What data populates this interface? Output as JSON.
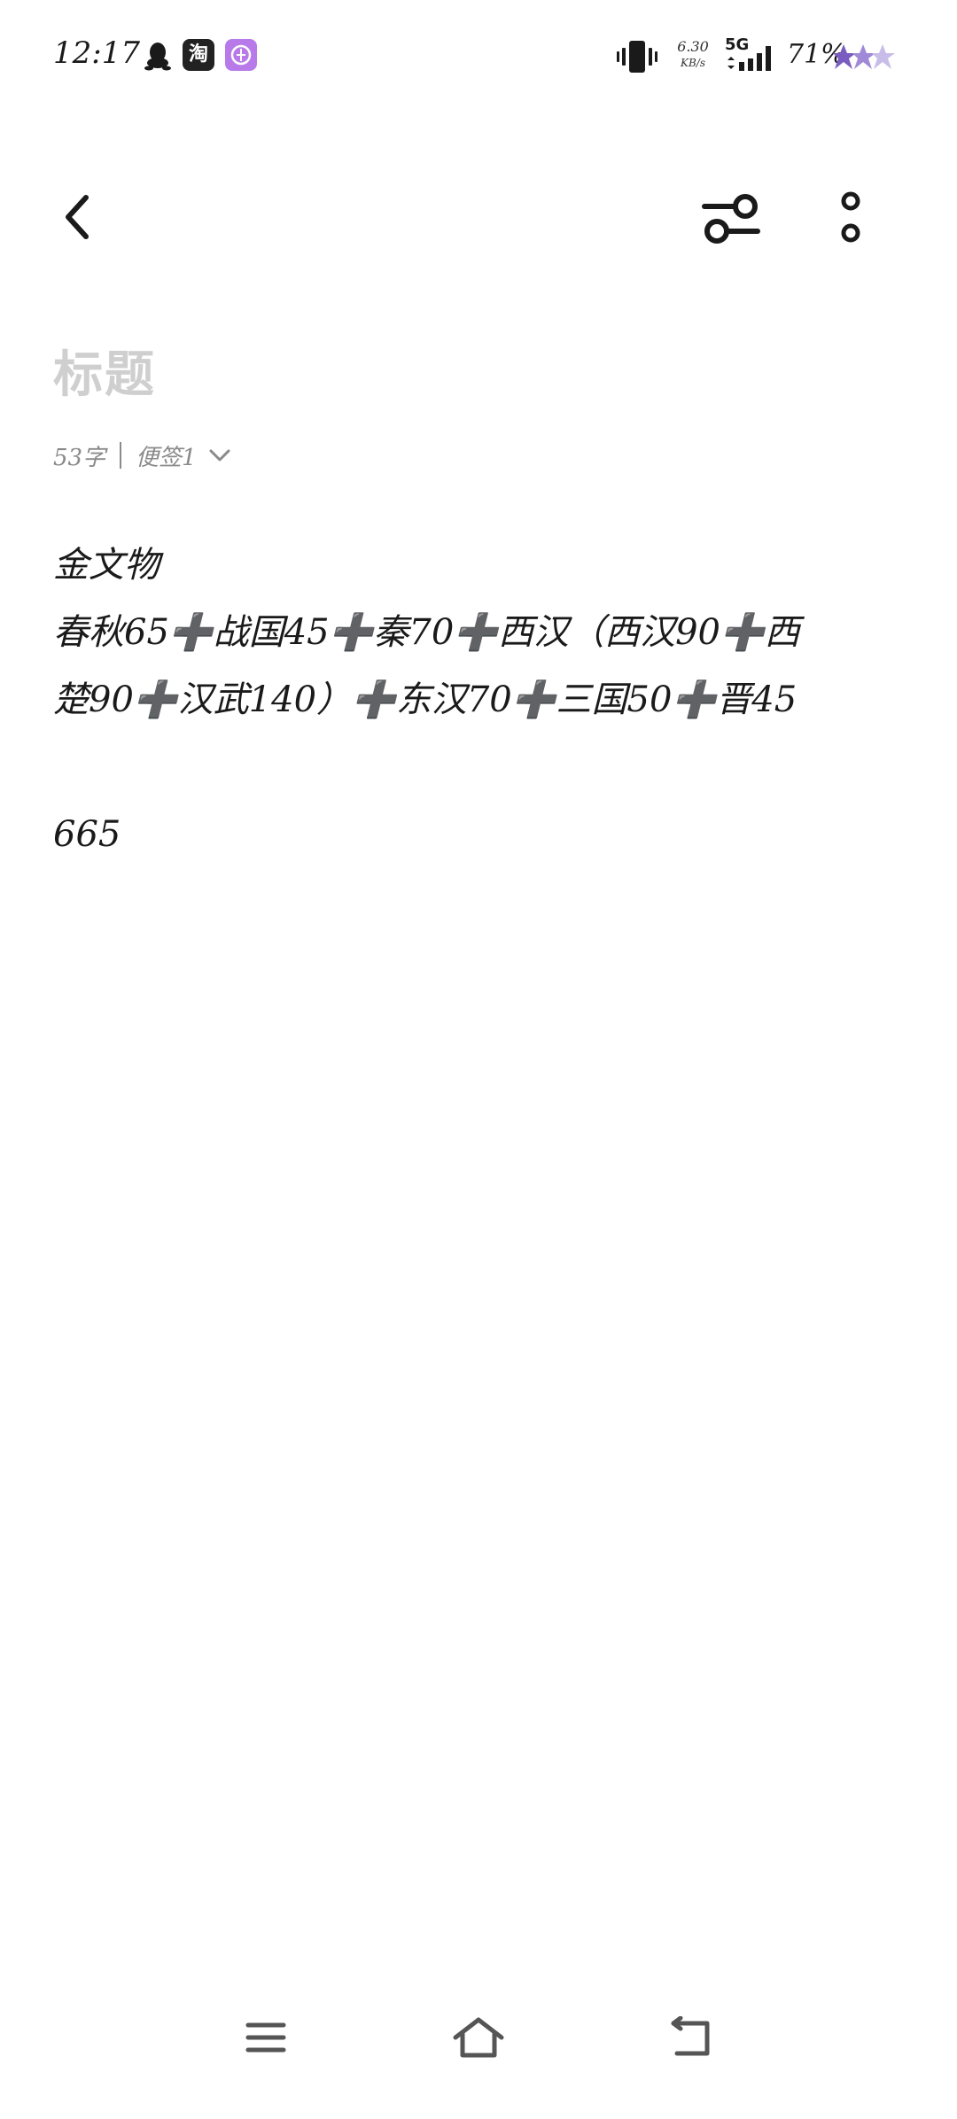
{
  "status_bar": {
    "time": "12:17",
    "taobao_glyph": "淘",
    "net_speed_value": "6.30",
    "net_speed_unit": "KB/s",
    "network_type": "5G",
    "battery": "71%"
  },
  "note": {
    "title_placeholder": "标题",
    "char_count": "53字",
    "folder": "便签1",
    "lines": [
      "金文物",
      "春秋65➕战国45➕秦70➕西汉（西汉90➕西",
      "楚90➕汉武140）➕东汉70➕三国50➕晋45",
      "",
      "665"
    ]
  },
  "icons": {
    "back": "chevron-left-icon",
    "style": "sliders-icon",
    "more": "more-vertical-icon",
    "nav_menu": "menu-icon",
    "nav_home": "home-icon",
    "nav_back": "back-icon"
  }
}
